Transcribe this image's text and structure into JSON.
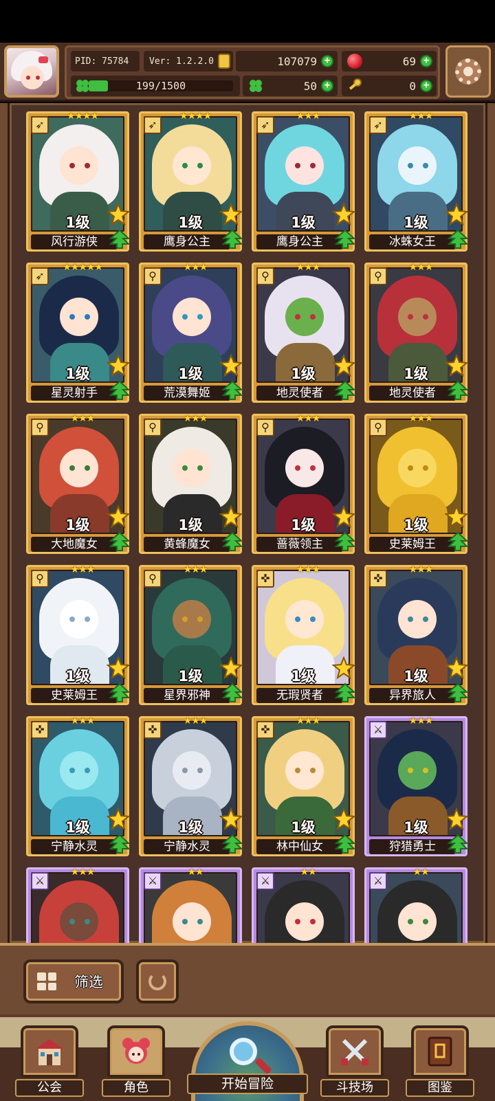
{
  "player": {
    "pid": "PID: 75784",
    "version": "Ver: 1.2.2.0",
    "gold": "107079",
    "gems": "69",
    "exp_text": "199/1500",
    "exp_progress": 0.1327,
    "clovers": "50",
    "keys": "0"
  },
  "icons": {
    "settings": "gear-icon",
    "gold": "gold-coin-icon",
    "gem": "red-gem-icon",
    "clover": "clover-icon",
    "key": "key-icon",
    "plus": "+"
  },
  "colors": {
    "gold_card": "#d69a3b",
    "purple_card": "#b58be0",
    "plus_green": "#3fbf3f",
    "star_yellow": "#ffd22e"
  },
  "cards": [
    {
      "name": "风行游侠",
      "level": "1级",
      "stars": "★★★★",
      "rarity": "gold",
      "class": "bow",
      "palette": [
        "#3f6a5e",
        "#f2efee",
        "#ffe3d3",
        "#9a2c36",
        "#3a5d4a"
      ]
    },
    {
      "name": "鹰身公主",
      "level": "1级",
      "stars": "★★★★",
      "rarity": "gold",
      "class": "bow",
      "palette": [
        "#2f5e5b",
        "#f3dc9a",
        "#ffe7d2",
        "#2c8a4a",
        "#2f4d44"
      ]
    },
    {
      "name": "鹰身公主",
      "level": "1级",
      "stars": "★★★",
      "rarity": "gold",
      "class": "bow",
      "palette": [
        "#3c4e66",
        "#6fd6e0",
        "#ffe3e0",
        "#9a2c36",
        "#3f4858"
      ]
    },
    {
      "name": "冰蛛女王",
      "level": "1级",
      "stars": "★★★",
      "rarity": "gold",
      "class": "bow",
      "palette": [
        "#2f4a62",
        "#8ed6ea",
        "#eaf4fb",
        "#3a8ab0",
        "#4a6d86"
      ]
    },
    {
      "name": "星灵射手",
      "level": "1级",
      "stars": "★★★★★",
      "rarity": "gold",
      "class": "bow",
      "palette": [
        "#3a5c6a",
        "#1c2a4a",
        "#ffe3d3",
        "#2a7ac0",
        "#3a8a8a"
      ]
    },
    {
      "name": "荒漠舞姬",
      "level": "1级",
      "stars": "★★★",
      "rarity": "gold",
      "class": "staff",
      "palette": [
        "#2f3f5a",
        "#4a4a88",
        "#ffe3d3",
        "#2a9ac0",
        "#2f5a5a"
      ]
    },
    {
      "name": "地灵使者",
      "level": "1级",
      "stars": "★★★",
      "rarity": "gold",
      "class": "staff",
      "palette": [
        "#3a3a4a",
        "#e8e2f0",
        "#6ab04c",
        "#c03040",
        "#8a6a3a"
      ]
    },
    {
      "name": "地灵使者",
      "level": "1级",
      "stars": "★★★",
      "rarity": "gold",
      "class": "staff",
      "palette": [
        "#3a3a42",
        "#b8303a",
        "#b88a5a",
        "#c03040",
        "#4a5a3a"
      ]
    },
    {
      "name": "大地魔女",
      "level": "1级",
      "stars": "★★★",
      "rarity": "gold",
      "class": "staff",
      "palette": [
        "#4a3a2a",
        "#d0503a",
        "#ffe3d3",
        "#3a7a3a",
        "#8a3a2a"
      ]
    },
    {
      "name": "黄蜂魔女",
      "level": "1级",
      "stars": "★★★",
      "rarity": "gold",
      "class": "staff",
      "palette": [
        "#3a3a2a",
        "#f0eae4",
        "#ffe3d3",
        "#3a8a3a",
        "#2a2a2a"
      ]
    },
    {
      "name": "蔷薇领主",
      "level": "1级",
      "stars": "★★★",
      "rarity": "gold",
      "class": "staff",
      "palette": [
        "#3a3a4a",
        "#1c1c24",
        "#f8e8e8",
        "#c03040",
        "#8a1c2a"
      ]
    },
    {
      "name": "史莱姆王",
      "level": "1级",
      "stars": "★★★",
      "rarity": "gold",
      "class": "staff",
      "palette": [
        "#7a5a1a",
        "#f0c030",
        "#f8d860",
        "#c08a10",
        "#e0a820"
      ]
    },
    {
      "name": "史莱姆王",
      "level": "1级",
      "stars": "★★★",
      "rarity": "gold",
      "class": "staff",
      "palette": [
        "#2f4a62",
        "#f0f4f8",
        "#ffffff",
        "#8aa8c8",
        "#e0e8f0"
      ]
    },
    {
      "name": "星界邪神",
      "level": "1级",
      "stars": "★★★",
      "rarity": "gold",
      "class": "staff",
      "palette": [
        "#2a3a3a",
        "#2f6a5a",
        "#a87a4a",
        "#d8a020",
        "#2a5a4a"
      ]
    },
    {
      "name": "无瑕贤者",
      "level": "1级",
      "stars": "★★★",
      "rarity": "gold",
      "class": "cross",
      "palette": [
        "#d0c8d8",
        "#f8e08a",
        "#ffe7d2",
        "#3a8ac0",
        "#f0f0f8"
      ]
    },
    {
      "name": "异界旅人",
      "level": "1级",
      "stars": "★★★",
      "rarity": "gold",
      "class": "cross",
      "palette": [
        "#3a4a5a",
        "#2a3a5a",
        "#ffe3d3",
        "#3a8a9a",
        "#8a4a2a"
      ]
    },
    {
      "name": "宁静水灵",
      "level": "1级",
      "stars": "★★★",
      "rarity": "gold",
      "class": "cross",
      "palette": [
        "#2f5a6a",
        "#6ad0e0",
        "#9ae8f0",
        "#3a9ab0",
        "#4ab8d0"
      ]
    },
    {
      "name": "宁静水灵",
      "level": "1级",
      "stars": "★★★",
      "rarity": "gold",
      "class": "cross",
      "palette": [
        "#2f3a4a",
        "#c8d0dc",
        "#e8ecf2",
        "#8a98a8",
        "#a8b4c4"
      ]
    },
    {
      "name": "林中仙女",
      "level": "1级",
      "stars": "★★★",
      "rarity": "gold",
      "class": "cross",
      "palette": [
        "#3a5a4a",
        "#f0d080",
        "#ffe7d2",
        "#b88a3a",
        "#3a6a3a"
      ]
    },
    {
      "name": "狩猎勇士",
      "level": "1级",
      "stars": "★★★",
      "rarity": "purple",
      "class": "sword",
      "palette": [
        "#3a3a4a",
        "#1c2a4a",
        "#5aa85a",
        "#d8c020",
        "#8a5a2a"
      ]
    },
    {
      "name": "",
      "level": "",
      "stars": "★★★",
      "rarity": "purple",
      "class": "sword",
      "palette": [
        "#3a2a2a",
        "#c8403a",
        "#7a4a3a",
        "#3a8a8a",
        "#3a2a2a"
      ]
    },
    {
      "name": "",
      "level": "",
      "stars": "★★",
      "rarity": "purple",
      "class": "sword",
      "palette": [
        "#3a3a3a",
        "#d0803a",
        "#ffe3d3",
        "#3a8a8a",
        "#3a2a2a"
      ]
    },
    {
      "name": "",
      "level": "",
      "stars": "★★",
      "rarity": "purple",
      "class": "sword",
      "palette": [
        "#3a3a4a",
        "#2a2a2a",
        "#ffe3d3",
        "#c0303a",
        "#4a4a4a"
      ]
    },
    {
      "name": "",
      "level": "",
      "stars": "★★",
      "rarity": "purple",
      "class": "sword",
      "palette": [
        "#3a4a5a",
        "#2a2a2a",
        "#ffe3d3",
        "#3a8a3a",
        "#6a6a6a"
      ]
    }
  ],
  "filter": {
    "label": "筛选",
    "icon": "grid-icon",
    "refresh_icon": "refresh-icon"
  },
  "nav": {
    "guild": "公会",
    "heroes": "角色",
    "adventure": "开始冒险",
    "arena": "斗技场",
    "codex": "图鉴",
    "active": "heroes"
  }
}
